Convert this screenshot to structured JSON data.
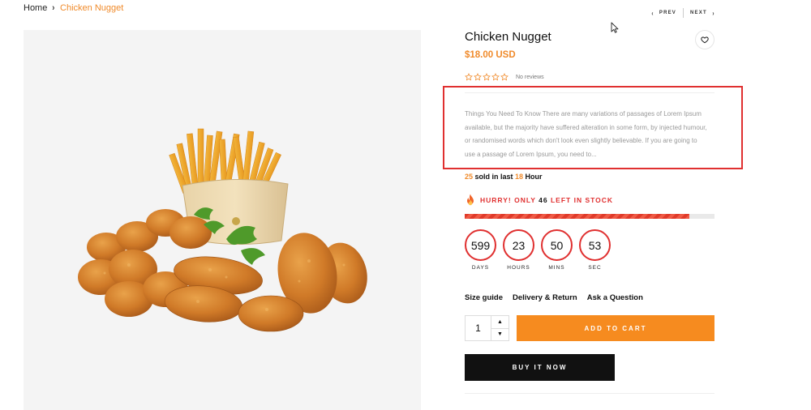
{
  "breadcrumb": {
    "home": "Home",
    "separator": "›",
    "current": "Chicken Nugget"
  },
  "pager": {
    "prev": "PREV",
    "next": "NEXT",
    "prev_icon": "chevron-left-icon",
    "next_icon": "chevron-right-icon"
  },
  "product": {
    "title": "Chicken Nugget",
    "price": "$18.00 USD",
    "rating": 0,
    "reviews_label": "No reviews",
    "wishlist_icon": "heart-icon",
    "description": "Things You Need To Know There are many variations of passages of Lorem Ipsum available, but the majority have suffered alteration in some form, by injected humour, or randomised words which don't look even slightly believable. If you are going to use a passage of Lorem Ipsum, you need to..."
  },
  "sold": {
    "count": "25",
    "text_mid": " sold in last ",
    "hours": "18",
    "text_end": " Hour"
  },
  "stock": {
    "prefix": "HURRY! ONLY ",
    "count": "46",
    "suffix": " LEFT IN STOCK",
    "level": 0.9,
    "icon": "fire-icon"
  },
  "countdown": [
    {
      "value": "599",
      "label": "DAYS"
    },
    {
      "value": "23",
      "label": "HOURS"
    },
    {
      "value": "50",
      "label": "MINS"
    },
    {
      "value": "53",
      "label": "SEC"
    }
  ],
  "links": {
    "size_guide": "Size guide",
    "delivery": "Delivery & Return",
    "ask": "Ask a Question"
  },
  "quantity": {
    "value": "1",
    "up": "▲",
    "down": "▼"
  },
  "buttons": {
    "add_to_cart": "ADD TO CART",
    "buy_now": "BUY IT NOW"
  },
  "colors": {
    "accent": "#f68b1f",
    "alert": "#e03030",
    "dark": "#111111"
  }
}
